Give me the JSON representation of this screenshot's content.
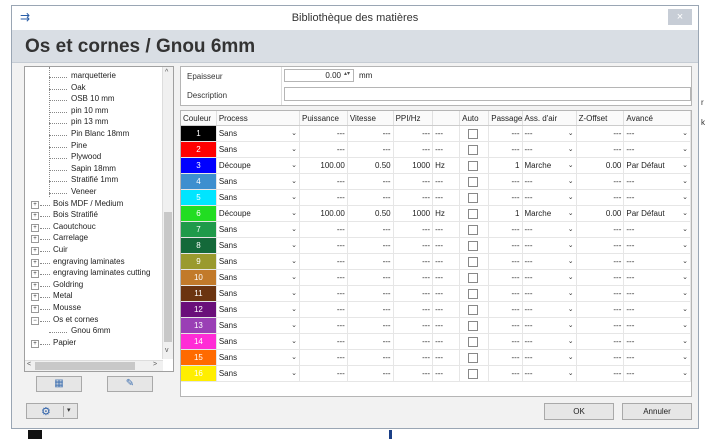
{
  "window": {
    "title": "Bibliothèque des matières",
    "close_glyph": "×"
  },
  "heading": "Os et cornes / Gnou 6mm",
  "tree": [
    {
      "label": "marquetterie",
      "level": 2
    },
    {
      "label": "Oak",
      "level": 2
    },
    {
      "label": "OSB 10 mm",
      "level": 2
    },
    {
      "label": "pin 10 mm",
      "level": 2
    },
    {
      "label": "pin 13 mm",
      "level": 2
    },
    {
      "label": "Pin Blanc 18mm",
      "level": 2
    },
    {
      "label": "Pine",
      "level": 2
    },
    {
      "label": "Plywood",
      "level": 2
    },
    {
      "label": "Sapin 18mm",
      "level": 2
    },
    {
      "label": "Stratifié 1mm",
      "level": 2
    },
    {
      "label": "Veneer",
      "level": 2
    },
    {
      "label": "Bois MDF / Medium",
      "level": 1,
      "expand": "+"
    },
    {
      "label": "Bois Stratifié",
      "level": 1,
      "expand": "+"
    },
    {
      "label": "Caoutchouc",
      "level": 1,
      "expand": "+"
    },
    {
      "label": "Carrelage",
      "level": 1,
      "expand": "+"
    },
    {
      "label": "Cuir",
      "level": 1,
      "expand": "+"
    },
    {
      "label": "engraving laminates",
      "level": 1,
      "expand": "+"
    },
    {
      "label": "engraving laminates cutting",
      "level": 1,
      "expand": "+"
    },
    {
      "label": "Goldring",
      "level": 1,
      "expand": "+"
    },
    {
      "label": "Metal",
      "level": 1,
      "expand": "+"
    },
    {
      "label": "Mousse",
      "level": 1,
      "expand": "+"
    },
    {
      "label": "Os et cornes",
      "level": 1,
      "expand": "−"
    },
    {
      "label": "Gnou 6mm",
      "level": 2
    },
    {
      "label": "Papier",
      "level": 1,
      "expand": "+"
    }
  ],
  "props": {
    "epaisseur_label": "Epaisseur",
    "epaisseur_value": "0.00",
    "epaisseur_unit": "mm",
    "description_label": "Description",
    "description_value": ""
  },
  "columns": [
    "Couleur",
    "Process",
    "Puissance",
    "Vitesse",
    "PPI/Hz",
    "",
    "Auto",
    "Passage",
    "Ass. d'air",
    "Z-Offset",
    "Avancé"
  ],
  "rows": [
    {
      "n": "1",
      "color": "#000000",
      "process": "Sans",
      "puissance": "---",
      "vitesse": "---",
      "ppi": "---",
      "unit": "---",
      "passage": "---",
      "air": "---",
      "zoffset": "---",
      "avance": "---"
    },
    {
      "n": "2",
      "color": "#ff0000",
      "process": "Sans",
      "puissance": "---",
      "vitesse": "---",
      "ppi": "---",
      "unit": "---",
      "passage": "---",
      "air": "---",
      "zoffset": "---",
      "avance": "---"
    },
    {
      "n": "3",
      "color": "#0000ff",
      "process": "Découpe",
      "puissance": "100.00",
      "vitesse": "0.50",
      "ppi": "1000",
      "unit": "Hz",
      "passage": "1",
      "air": "Marche",
      "zoffset": "0.00",
      "avance": "Par Défaut"
    },
    {
      "n": "4",
      "color": "#3d8fcf",
      "process": "Sans",
      "puissance": "---",
      "vitesse": "---",
      "ppi": "---",
      "unit": "---",
      "passage": "---",
      "air": "---",
      "zoffset": "---",
      "avance": "---"
    },
    {
      "n": "5",
      "color": "#00e5ff",
      "process": "Sans",
      "puissance": "---",
      "vitesse": "---",
      "ppi": "---",
      "unit": "---",
      "passage": "---",
      "air": "---",
      "zoffset": "---",
      "avance": "---"
    },
    {
      "n": "6",
      "color": "#22dd22",
      "process": "Découpe",
      "puissance": "100.00",
      "vitesse": "0.50",
      "ppi": "1000",
      "unit": "Hz",
      "passage": "1",
      "air": "Marche",
      "zoffset": "0.00",
      "avance": "Par Défaut"
    },
    {
      "n": "7",
      "color": "#1f9a4a",
      "process": "Sans",
      "puissance": "---",
      "vitesse": "---",
      "ppi": "---",
      "unit": "---",
      "passage": "---",
      "air": "---",
      "zoffset": "---",
      "avance": "---"
    },
    {
      "n": "8",
      "color": "#14693a",
      "process": "Sans",
      "puissance": "---",
      "vitesse": "---",
      "ppi": "---",
      "unit": "---",
      "passage": "---",
      "air": "---",
      "zoffset": "---",
      "avance": "---"
    },
    {
      "n": "9",
      "color": "#9a9a2e",
      "process": "Sans",
      "puissance": "---",
      "vitesse": "---",
      "ppi": "---",
      "unit": "---",
      "passage": "---",
      "air": "---",
      "zoffset": "---",
      "avance": "---"
    },
    {
      "n": "10",
      "color": "#c27a2a",
      "process": "Sans",
      "puissance": "---",
      "vitesse": "---",
      "ppi": "---",
      "unit": "---",
      "passage": "---",
      "air": "---",
      "zoffset": "---",
      "avance": "---"
    },
    {
      "n": "11",
      "color": "#6b3410",
      "process": "Sans",
      "puissance": "---",
      "vitesse": "---",
      "ppi": "---",
      "unit": "---",
      "passage": "---",
      "air": "---",
      "zoffset": "---",
      "avance": "---"
    },
    {
      "n": "12",
      "color": "#6a0f7a",
      "process": "Sans",
      "puissance": "---",
      "vitesse": "---",
      "ppi": "---",
      "unit": "---",
      "passage": "---",
      "air": "---",
      "zoffset": "---",
      "avance": "---"
    },
    {
      "n": "13",
      "color": "#9a3fb5",
      "process": "Sans",
      "puissance": "---",
      "vitesse": "---",
      "ppi": "---",
      "unit": "---",
      "passage": "---",
      "air": "---",
      "zoffset": "---",
      "avance": "---"
    },
    {
      "n": "14",
      "color": "#ff2bd6",
      "process": "Sans",
      "puissance": "---",
      "vitesse": "---",
      "ppi": "---",
      "unit": "---",
      "passage": "---",
      "air": "---",
      "zoffset": "---",
      "avance": "---"
    },
    {
      "n": "15",
      "color": "#ff6a00",
      "process": "Sans",
      "puissance": "---",
      "vitesse": "---",
      "ppi": "---",
      "unit": "---",
      "passage": "---",
      "air": "---",
      "zoffset": "---",
      "avance": "---"
    },
    {
      "n": "16",
      "color": "#ffee00",
      "process": "Sans",
      "puissance": "---",
      "vitesse": "---",
      "ppi": "---",
      "unit": "---",
      "passage": "---",
      "air": "---",
      "zoffset": "---",
      "avance": "---"
    }
  ],
  "buttons": {
    "ok": "OK",
    "cancel": "Annuler"
  },
  "icons": {
    "add_material": "add-material-icon",
    "edit_material": "edit-material-icon",
    "settings": "gear-icon"
  },
  "side_chars": [
    "r",
    "k"
  ]
}
